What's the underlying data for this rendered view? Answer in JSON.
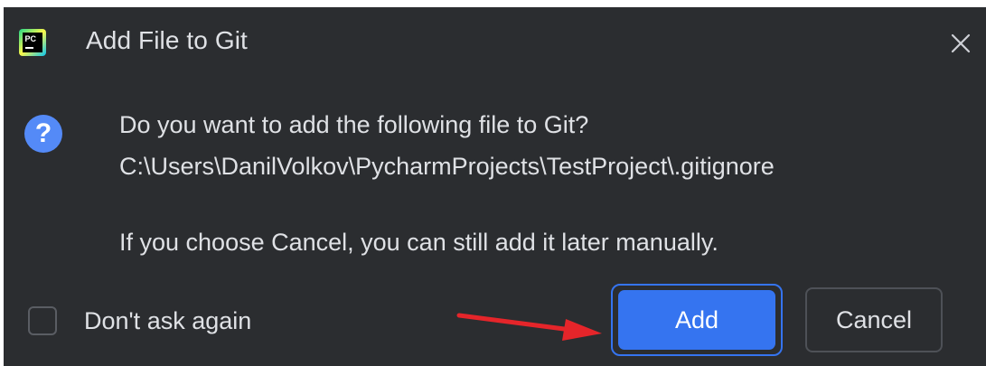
{
  "dialog": {
    "title": "Add File to Git",
    "app_icon": "pycharm-icon",
    "close_icon": "close-icon"
  },
  "message": {
    "icon": "question-icon",
    "icon_glyph": "?",
    "line1": "Do you want to add the following file to Git?",
    "line2": "C:\\Users\\DanilVolkov\\PycharmProjects\\TestProject\\.gitignore",
    "line3": "If you choose Cancel, you can still add it later manually."
  },
  "footer": {
    "checkbox_label": "Don't ask again",
    "checkbox_checked": false,
    "add_label": "Add",
    "cancel_label": "Cancel"
  },
  "annotation": {
    "arrow_color": "#e5252a",
    "points_to": "add-button"
  },
  "colors": {
    "background": "#2b2d30",
    "text": "#dfe1e5",
    "accent": "#3574f0",
    "question_icon": "#548af7"
  }
}
